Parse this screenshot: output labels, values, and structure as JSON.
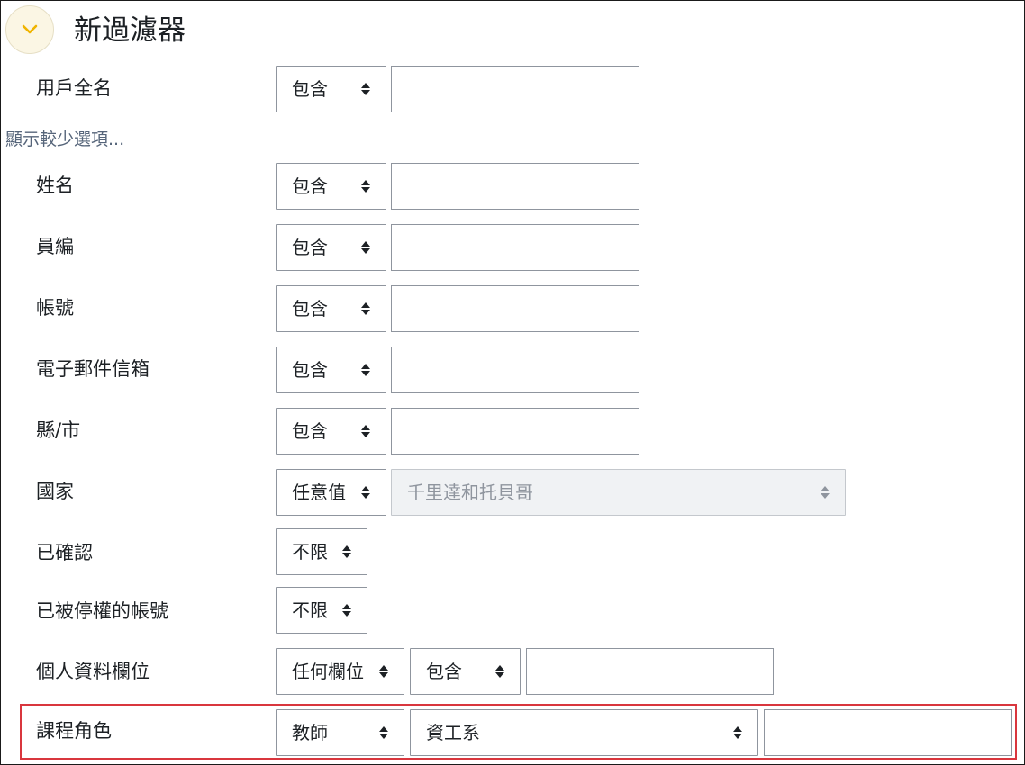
{
  "header": {
    "title": "新過濾器",
    "toggle_icon": "chevron-down-icon"
  },
  "show_less_link": "顯示較少選項...",
  "rows": {
    "fullname": {
      "label": "用戶全名",
      "operator": "包含",
      "value": ""
    },
    "firstname": {
      "label": "姓名",
      "operator": "包含",
      "value": ""
    },
    "idnumber": {
      "label": "員編",
      "operator": "包含",
      "value": ""
    },
    "username": {
      "label": "帳號",
      "operator": "包含",
      "value": ""
    },
    "email": {
      "label": "電子郵件信箱",
      "operator": "包含",
      "value": ""
    },
    "city": {
      "label": "縣/市",
      "operator": "包含",
      "value": ""
    },
    "country": {
      "label": "國家",
      "operator": "任意值",
      "value": "千里達和托貝哥"
    },
    "confirmed": {
      "label": "已確認",
      "value": "不限"
    },
    "suspended": {
      "label": "已被停權的帳號",
      "value": "不限"
    },
    "profile": {
      "label": "個人資料欄位",
      "field": "任何欄位",
      "operator": "包含",
      "value": ""
    },
    "courserole": {
      "label": "課程角色",
      "role": "教師",
      "category": "資工系",
      "value": ""
    }
  },
  "colors": {
    "highlight_border": "#d9363e",
    "link": "#56657a",
    "toggle_bg": "#fbf6e4",
    "toggle_icon": "#f0b400"
  }
}
